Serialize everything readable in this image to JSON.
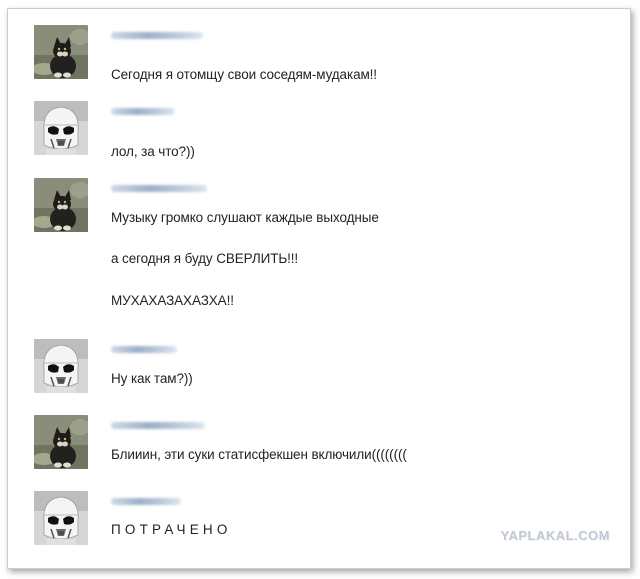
{
  "messages": [
    {
      "sender_avatar": "cat-avatar",
      "lines": [
        "Сегодня я отомщу свои соседям-мудакам!!"
      ]
    },
    {
      "sender_avatar": "stormtrooper-avatar",
      "lines": [
        "лол, за что?))"
      ]
    },
    {
      "sender_avatar": "cat-avatar",
      "lines": [
        "Музыку громко слушают каждые выходные",
        "а сегодня я буду СВЕРЛИТЬ!!!",
        "МУХАХАЗАХАЗХА!!"
      ]
    },
    {
      "sender_avatar": "stormtrooper-avatar",
      "lines": [
        "Ну как там?))"
      ]
    },
    {
      "sender_avatar": "cat-avatar",
      "lines": [
        "Блииин, эти суки статисфекшен включили(((((((("
      ]
    },
    {
      "sender_avatar": "stormtrooper-avatar",
      "lines": [
        "ПОТРАЧЕНО"
      ]
    }
  ],
  "watermark": "YAPLAKAL.COM",
  "colors": {
    "text": "#232323",
    "name_blur": "#9bb0c8",
    "border": "#c9cdd3",
    "watermark": "#c2c9d3"
  }
}
